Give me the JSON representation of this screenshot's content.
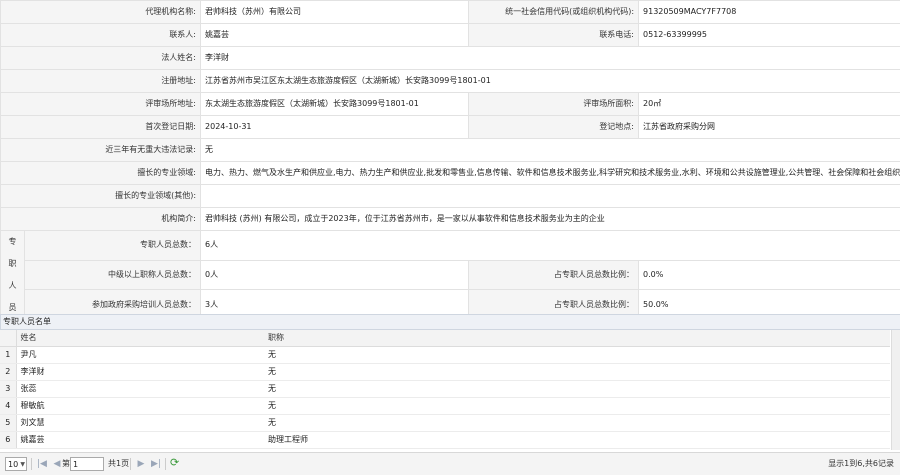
{
  "info": {
    "agency_name_label": "代理机构名称:",
    "agency_name": "君帅科技（苏州）有限公司",
    "credit_code_label": "统一社会信用代码(或组织机构代码):",
    "credit_code": "91320509MACY7F7708",
    "contact_label": "联系人:",
    "contact": "姚嘉芸",
    "phone_label": "联系电话:",
    "phone": "0512-63399995",
    "legal_rep_label": "法人姓名:",
    "legal_rep": "李洋财",
    "reg_address_label": "注册地址:",
    "reg_address": "江苏省苏州市吴江区东太湖生态旅游度假区（太湖新城）长安路3099号1801-01",
    "review_address_label": "评审场所地址:",
    "review_address": "东太湖生态旅游度假区（太湖新城）长安路3099号1801-01",
    "review_area_label": "评审场所面积:",
    "review_area": "20㎡",
    "first_reg_date_label": "首次登记日期:",
    "first_reg_date": "2024-10-31",
    "reg_place_label": "登记地点:",
    "reg_place": "江苏省政府采购分网",
    "violations_label": "近三年有无重大违法记录:",
    "violations": "无",
    "specialty_label": "擅长的专业领域:",
    "specialty": "电力、热力、燃气及水生产和供应业,电力、热力生产和供应业,批发和零售业,信息传输、软件和信息技术服务业,科学研究和技术服务业,水利、环境和公共设施管理业,公共管理、社会保障和社会组织",
    "specialty_other_label": "擅长的专业领域(其他):",
    "specialty_other": "",
    "intro_label": "机构简介:",
    "intro": "君帅科技 (苏州) 有限公司，成立于2023年，位于江苏省苏州市，是一家以从事软件和信息技术服务业为主的企业"
  },
  "staff": {
    "side_label": [
      "专",
      "职",
      "人",
      "员"
    ],
    "total_label": "专职人员总数：",
    "total": "6人",
    "mid_label": "中级以上职称人员总数：",
    "mid": "0人",
    "mid_ratio_label": "占专职人员总数比例：",
    "mid_ratio": "0.0%",
    "trained_label": "参加政府采购培训人员总数：",
    "trained": "3人",
    "trained_ratio_label": "占专职人员总数比例：",
    "trained_ratio": "50.0%"
  },
  "grid": {
    "title": "专职人员名单",
    "col_name": "姓名",
    "col_title": "职称",
    "rows": [
      {
        "num": "1",
        "name": "尹凡",
        "title": "无"
      },
      {
        "num": "2",
        "name": "李洋财",
        "title": "无"
      },
      {
        "num": "3",
        "name": "张蕊",
        "title": "无"
      },
      {
        "num": "4",
        "name": "穆敏航",
        "title": "无"
      },
      {
        "num": "5",
        "name": "刘文慧",
        "title": "无"
      },
      {
        "num": "6",
        "name": "姚嘉芸",
        "title": "助理工程师"
      }
    ]
  },
  "pager": {
    "page_size": "10",
    "page_prefix": "第",
    "page_value": "1",
    "page_suffix": "共1页",
    "summary": "显示1到6,共6记录"
  }
}
